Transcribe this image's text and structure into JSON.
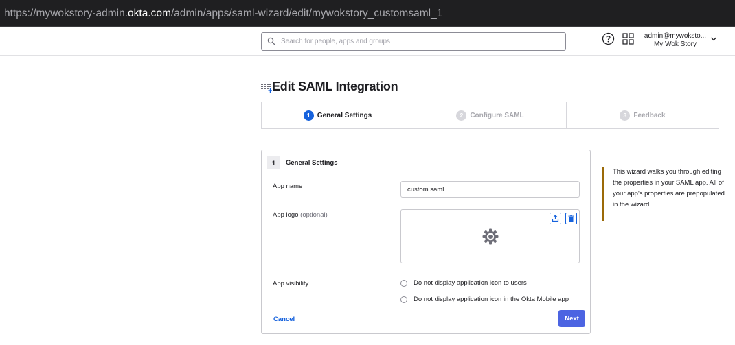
{
  "browser": {
    "url_prefix": "https://mywokstory-admin.",
    "url_domain": "okta.com",
    "url_path": "/admin/apps/saml-wizard/edit/mywokstory_customsaml_1"
  },
  "header": {
    "search_placeholder": "Search for people, apps and groups",
    "user_email": "admin@mywoksto...",
    "org_name": "My Wok Story"
  },
  "page": {
    "title": "Edit SAML Integration"
  },
  "stepper": {
    "steps": [
      {
        "number": "1",
        "label": "General Settings",
        "active": true
      },
      {
        "number": "2",
        "label": "Configure SAML",
        "active": false
      },
      {
        "number": "3",
        "label": "Feedback",
        "active": false
      }
    ]
  },
  "form": {
    "section_number": "1",
    "section_title": "General Settings",
    "app_name_label": "App name",
    "app_name_value": "custom saml",
    "app_logo_label": "App logo",
    "app_logo_optional": "(optional)",
    "app_visibility_label": "App visibility",
    "visibility_options": [
      "Do not display application icon to users",
      "Do not display application icon in the Okta Mobile app"
    ],
    "cancel_label": "Cancel",
    "next_label": "Next"
  },
  "aside": {
    "help_text": "This wizard walks you through editing the properties in your SAML app. All of your app's properties are prepopulated in the wizard."
  },
  "colors": {
    "accent": "#1662dd",
    "primary_button": "#4c64e2",
    "aside_border": "#9b6a08"
  }
}
